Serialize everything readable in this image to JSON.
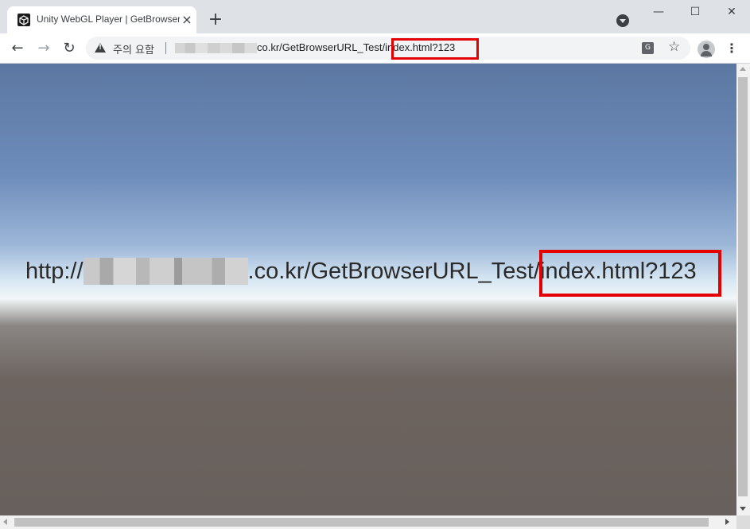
{
  "browser": {
    "tab": {
      "title": "Unity WebGL Player | GetBrowserURL_Test",
      "close_glyph": "×",
      "favicon": "unity-logo-icon"
    },
    "new_tab_glyph": "+",
    "window_controls": {
      "minimize": "—",
      "maximize": "☐",
      "close": "✕"
    },
    "nav": {
      "back": "←",
      "forward": "→",
      "reload": "↻"
    },
    "address_bar": {
      "security_label": "주의 요함",
      "url_visible_part": "co.kr/GetBrowserURL_Test/",
      "url_highlighted_part": "index.html?123",
      "host_obscured": true
    },
    "toolbar_icons": [
      "translate-icon",
      "star-icon",
      "profile-avatar-icon",
      "menu-icon"
    ],
    "menu_glyph": "⋮",
    "star_glyph": "☆"
  },
  "page": {
    "url_prefix": "http://",
    "url_suffix": ".co.kr/GetBrowserURL_Test/",
    "url_highlighted": "index.html?123",
    "highlight_color": "#e50000"
  }
}
